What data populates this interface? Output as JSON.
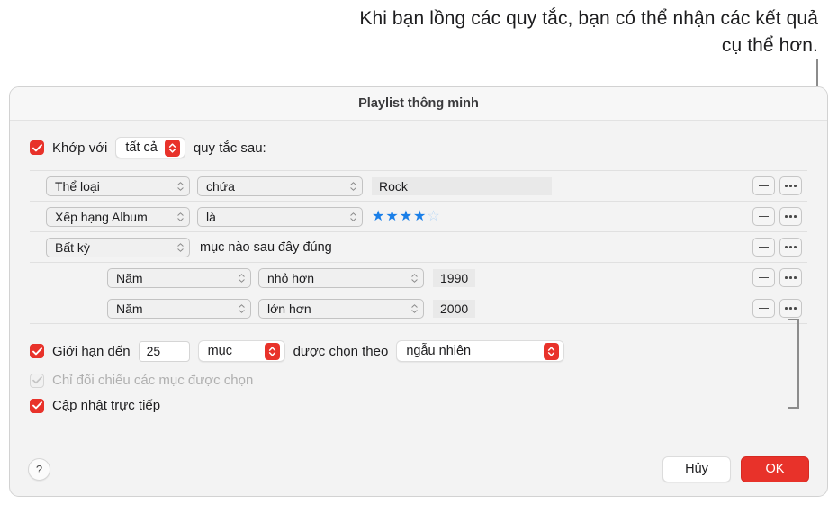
{
  "annotation": {
    "text": "Khi bạn lồng các quy tắc, bạn có thể nhận các kết quả cụ thể hơn."
  },
  "dialog": {
    "title": "Playlist thông minh",
    "match": {
      "prefix_label": "Khớp với",
      "selector_value": "tất cả",
      "suffix_label": "quy tắc sau:"
    },
    "rules": [
      {
        "field": "Thể loại",
        "operator": "chứa",
        "value": "Rock",
        "value_type": "text",
        "nested": false
      },
      {
        "field": "Xếp hạng Album",
        "operator": "là",
        "value": "★★★★☆",
        "value_type": "rating",
        "rating_filled": 4,
        "rating_total": 5,
        "nested": false
      },
      {
        "field": "Bất kỳ",
        "operator": "mục nào sau đây đúng",
        "value": "",
        "value_type": "group",
        "nested": false
      },
      {
        "field": "Năm",
        "operator": "nhỏ hơn",
        "value": "1990",
        "value_type": "text",
        "nested": true
      },
      {
        "field": "Năm",
        "operator": "lớn hơn",
        "value": "2000",
        "value_type": "text",
        "nested": true
      }
    ],
    "options": {
      "limit_label": "Giới hạn đến",
      "limit_value": "25",
      "limit_unit": "mục",
      "selected_by_label": "được chọn theo",
      "selected_by_value": "ngẫu nhiên",
      "match_checked_label": "Chỉ đối chiếu các mục được chọn",
      "live_update_label": "Cập nhật trực tiếp"
    },
    "footer": {
      "help_label": "?",
      "cancel_label": "Hủy",
      "ok_label": "OK"
    }
  },
  "colors": {
    "accent_red": "#e8322a",
    "star_blue": "#1a7fe8",
    "dialog_bg": "#f3f3f3"
  }
}
